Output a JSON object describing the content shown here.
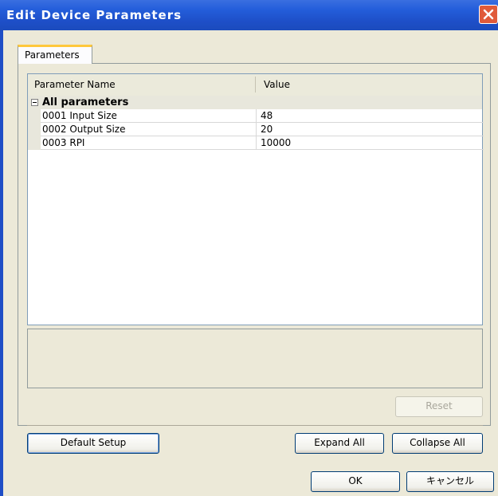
{
  "window": {
    "title": "Edit Device Parameters"
  },
  "tabs": [
    {
      "label": "Parameters"
    }
  ],
  "grid": {
    "columns": [
      "Parameter Name",
      "Value"
    ],
    "group_label": "All parameters",
    "rows": [
      {
        "name": "0001 Input Size",
        "value": "48"
      },
      {
        "name": "0002 Output Size",
        "value": "20"
      },
      {
        "name": "0003 RPI",
        "value": "10000"
      }
    ]
  },
  "buttons": {
    "reset": "Reset",
    "default_setup": "Default Setup",
    "expand_all": "Expand All",
    "collapse_all": "Collapse All",
    "ok": "OK",
    "cancel": "キャンセル"
  },
  "colors": {
    "titlebar": "#245edb",
    "tab_accent": "#ffc83c",
    "face": "#ece9d8"
  },
  "icons": {
    "close": "close-icon",
    "collapse": "minus-box-icon"
  }
}
